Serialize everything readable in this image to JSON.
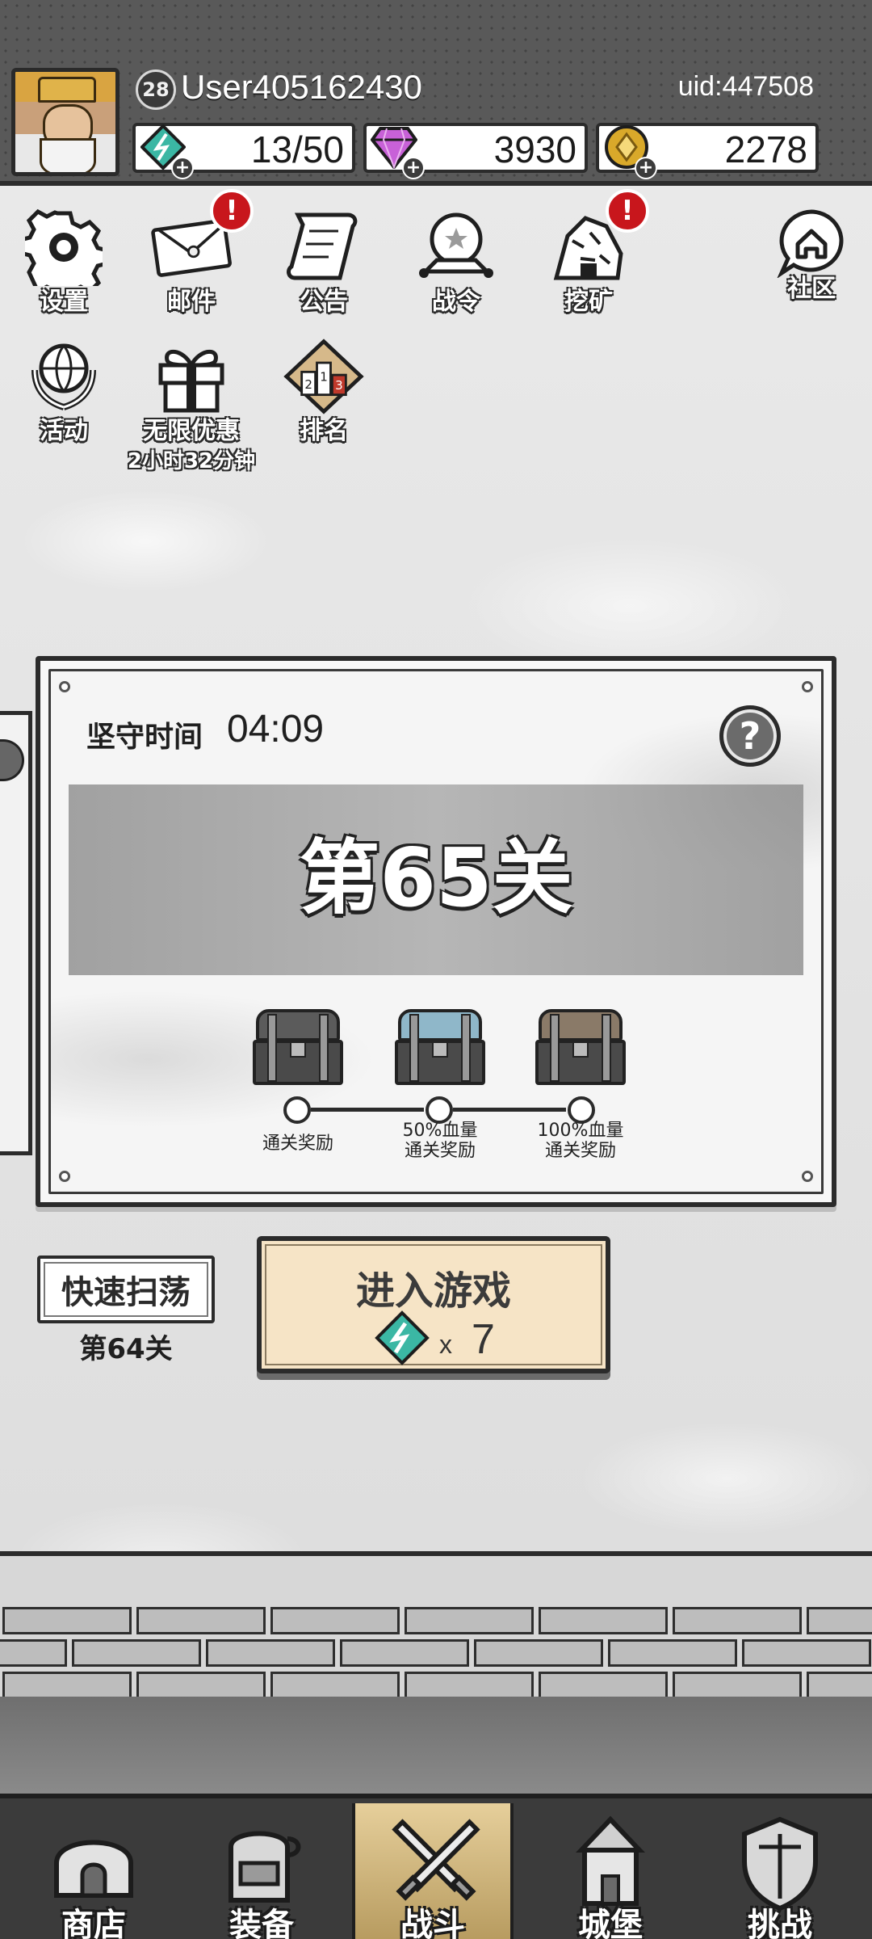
{
  "header": {
    "level": "28",
    "username": "User405162430",
    "uid": "uid:447508",
    "resources": {
      "energy": "13/50",
      "gems": "3930",
      "coins": "2278"
    }
  },
  "features": {
    "settings": "设置",
    "mail": "邮件",
    "notice": "公告",
    "battle_pass": "战令",
    "mining": "挖矿",
    "community": "社区",
    "events": "活动",
    "unlimited_offer": "无限优惠",
    "offer_timer": "2小时32分钟",
    "ranking": "排名",
    "ranking_numbers": [
      "2",
      "1",
      "3"
    ],
    "alert_mark": "!"
  },
  "stage": {
    "hold_label": "坚守时间",
    "hold_time": "04:09",
    "help": "?",
    "title": "第65关",
    "rewards": [
      {
        "line1": "通关奖励",
        "line2": ""
      },
      {
        "line1": "50%血量",
        "line2": "通关奖励"
      },
      {
        "line1": "100%血量",
        "line2": "通关奖励"
      }
    ]
  },
  "actions": {
    "sweep_label": "快速扫荡",
    "sweep_stage": "第64关",
    "enter_label": "进入游戏",
    "enter_cost_x": "x",
    "enter_cost": "7"
  },
  "nav": {
    "shop": "商店",
    "equipment": "装备",
    "battle": "战斗",
    "castle": "城堡",
    "challenge": "挑战",
    "active": "battle"
  },
  "colors": {
    "energy_icon": "#3bb7a4",
    "gem_icon": "#c861d8",
    "coin_icon": "#d9a92a",
    "alert": "#c8161c",
    "enter_button": "#f6e4c6",
    "active_tab": "#d4bb82"
  },
  "icons": {
    "energy": "lightning-gem-icon",
    "gem": "diamond-icon",
    "coin": "gold-coin-icon",
    "settings": "gear-icon",
    "mail": "envelope-icon",
    "notice": "scroll-icon",
    "battle_pass": "crystal-ball-icon",
    "mining": "ore-rock-icon",
    "community": "home-bubble-icon",
    "events": "laurel-globe-icon",
    "offer": "gift-box-icon",
    "ranking": "podium-icon"
  }
}
